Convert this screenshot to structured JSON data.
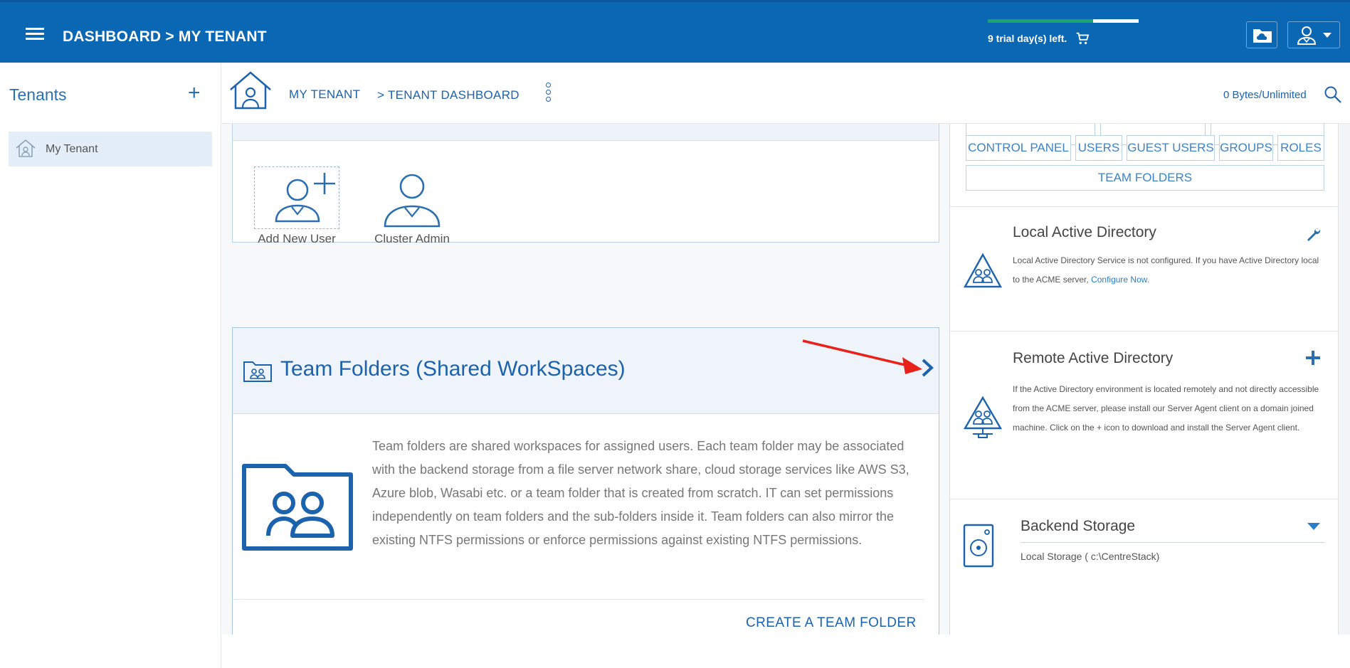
{
  "topbar": {
    "title": "DASHBOARD > MY TENANT",
    "trial_text": "9 trial day(s) left.",
    "trial_progress": 0.7,
    "colors": {
      "bar": "#0a67b3",
      "trial_fill": "#1aa36b"
    },
    "icons": {
      "menu": "hamburger-menu-icon",
      "cart": "cart-icon",
      "cloud": "cloud-folder-icon",
      "user": "user-menu-icon"
    }
  },
  "sidebar": {
    "title": "Tenants",
    "add_label": "+",
    "items": [
      {
        "label": "My Tenant",
        "icon": "home-icon"
      }
    ]
  },
  "header": {
    "tenant": "MY TENANT",
    "dashboard": "> TENANT DASHBOARD",
    "storage": "0 Bytes/Unlimited"
  },
  "users_card": {
    "tiles": [
      {
        "label": "Add New User",
        "icon": "add-user-icon"
      },
      {
        "label": "Cluster Admin",
        "icon": "user-icon"
      }
    ]
  },
  "team_card": {
    "title": "Team Folders (Shared WorkSpaces)",
    "description": "Team folders are shared workspaces for assigned users. Each team folder may be associated with the backend storage from a file server network share, cloud storage services like AWS S3, Azure blob, Wasabi etc. or a team folder that is created from scratch. IT can set permissions independently on team folders and the sub-folders inside it. Team folders can also mirror the existing NTFS permissions or enforce permissions against existing NTFS permissions.",
    "create_link": "CREATE A TEAM FOLDER"
  },
  "right_panel": {
    "buttons": [
      "CONTROL PANEL",
      "USERS",
      "GUEST USERS",
      "GROUPS",
      "ROLES"
    ],
    "team_folders_button": "TEAM FOLDERS",
    "local_ad": {
      "title": "Local Active Directory",
      "text": "Local Active Directory Service is not configured. If you have Active Directory local to the ACME server,",
      "link": "Configure Now."
    },
    "remote_ad": {
      "title": "Remote Active Directory",
      "text": "If the Active Directory environment is located remotely and not directly accessible from the ACME server, please install our Server Agent client on a domain joined machine. Click on the + icon to download and install the Server Agent client."
    },
    "backend": {
      "title": "Backend Storage",
      "value": "Local Storage ( c:\\CentreStack)"
    }
  }
}
